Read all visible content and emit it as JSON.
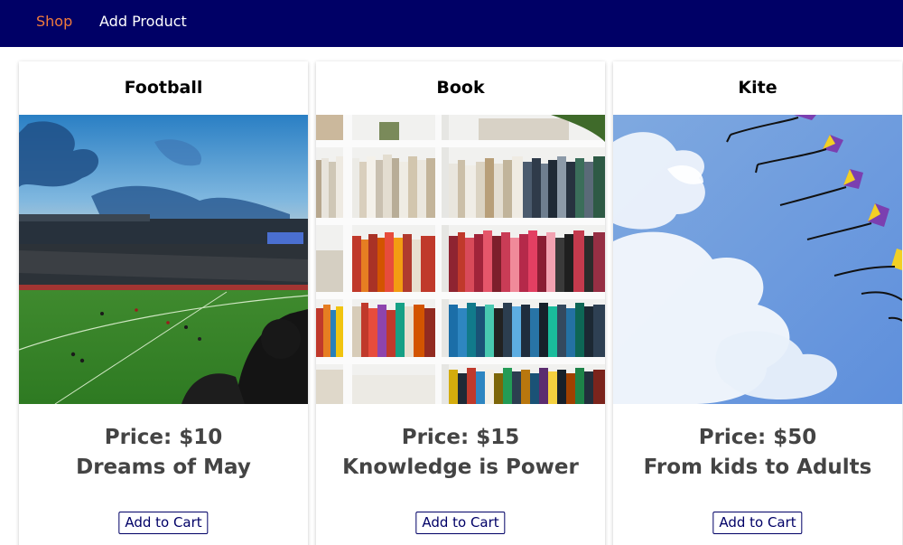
{
  "nav": {
    "shop_label": "Shop",
    "add_product_label": "Add Product",
    "active_color": "#f07a3c",
    "bg_color": "#000066"
  },
  "products": [
    {
      "title": "Football",
      "price": "Price: $10",
      "description": "Dreams of May",
      "button": "Add to Cart",
      "image": "football-stadium-image"
    },
    {
      "title": "Book",
      "price": "Price: $15",
      "description": "Knowledge is Power",
      "button": "Add to Cart",
      "image": "bookshelf-image"
    },
    {
      "title": "Kite",
      "price": "Price: $50",
      "description": "From kids to Adults",
      "button": "Add to Cart",
      "image": "kites-in-sky-image"
    }
  ]
}
